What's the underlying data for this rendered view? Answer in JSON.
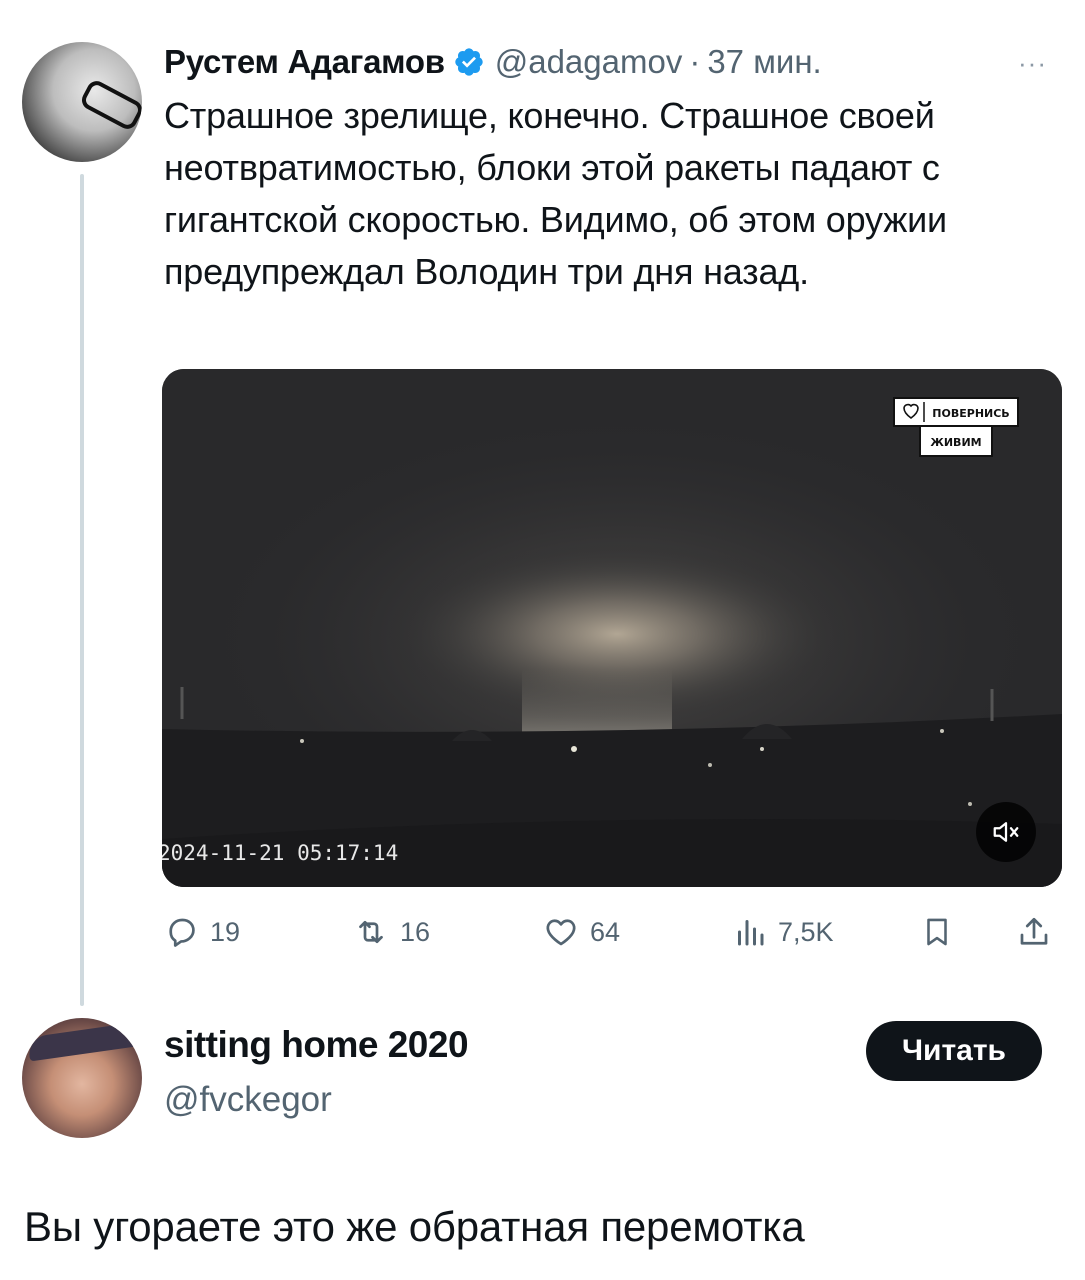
{
  "tweet": {
    "author_name": "Рустем Адагамов",
    "handle": "@adagamov",
    "separator": "·",
    "time": "37 мин.",
    "more": "···",
    "text": "Страшное зрелище, конечно. Страшное своей неотвратимостью, блоки этой ракеты падают с гигантской скоростью. Видимо, об этом оружии предупреждал Володин три дня назад.",
    "media": {
      "timestamp": "2024-11-21 05:17:14",
      "watermark_line1": "ПОВЕРНИСЬ",
      "watermark_line2": "ЖИВИМ",
      "sound": "muted"
    },
    "actions": {
      "replies": "19",
      "retweets": "16",
      "likes": "64",
      "views": "7,5K"
    }
  },
  "suggested_user": {
    "name": "sitting home 2020",
    "handle": "@fvckegor",
    "follow_label": "Читать"
  },
  "caption": "Вы угораете это же обратная перемотка",
  "colors": {
    "text": "#0f1419",
    "secondary": "#536471",
    "verified": "#1d9bf0",
    "thread_line": "#cfd9de"
  }
}
